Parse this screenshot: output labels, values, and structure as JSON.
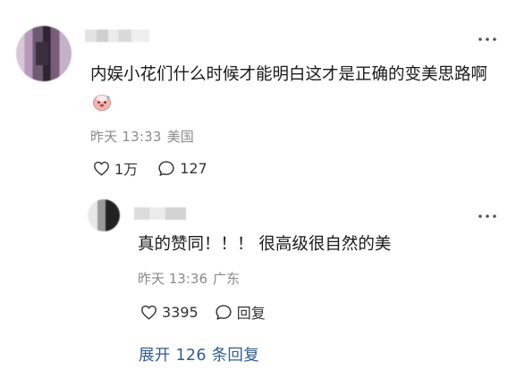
{
  "comment": {
    "text": "内娱小花们什么时候才能明白这才是正确的变美思路啊",
    "emoji_name": "sticker-face",
    "time": "昨天 13:33",
    "location": "美国",
    "likes": "1万",
    "replies": "127",
    "more_icon": "more-dots-icon"
  },
  "reply": {
    "text": "真的赞同！！！ 很高级很自然的美",
    "time": "昨天 13:36",
    "location": "广东",
    "likes": "3395",
    "reply_label": "回复"
  },
  "expand": {
    "label": "展开 126 条回复"
  },
  "colors": {
    "text": "#1a1a1a",
    "meta": "#8a8a8a",
    "link": "#2f5d95"
  }
}
